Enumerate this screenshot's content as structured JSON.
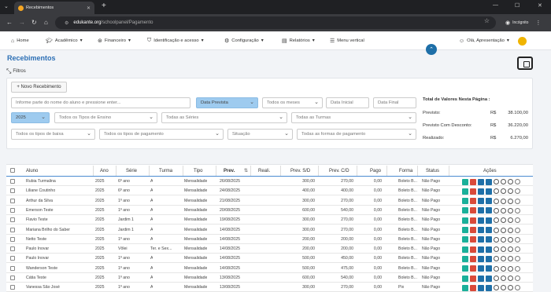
{
  "browser": {
    "tab_title": "Recebimentos",
    "url_host": "edukante.org",
    "url_path": "/schoolpanel/Pagamento",
    "incognito_label": "Incógnito"
  },
  "nav": {
    "home": "Home",
    "academico": "Acadêmico",
    "financeiro": "Financeiro",
    "identificacao": "Identificação e acesso",
    "configuracao": "Configuração",
    "relatorios": "Relatórios",
    "menu_vertical": "Menu vertical",
    "greeting": "Olá, Apresentação"
  },
  "page": {
    "title": "Recebimentos",
    "filters_label": "Filtros",
    "new_button": "+ Novo Recebimento"
  },
  "filters": {
    "search_placeholder": "Informe parte do nome do aluno e pressione enter...",
    "prevista": "Data Prevista",
    "todos_meses": "Todos os meses",
    "data_inicial": "Data Inicial",
    "data_final": "Data Final",
    "ano": "2025",
    "tipos_ensino": "Todos os Tipos de Ensino",
    "series": "Todas as Séries",
    "turmas": "Todas as Turmas",
    "tipos_baixa": "Todos os tipos de baixa",
    "tipos_pagamento": "Todos os tipos de pagamento",
    "situacao": "Situação",
    "formas_pagamento": "Todas as formas de pagamento"
  },
  "totals": {
    "title": "Total de Valores Nesta Página :",
    "rows": [
      {
        "label": "Previsto:",
        "currency": "R$",
        "value": "38.100,00"
      },
      {
        "label": "Previsto Com Desconto:",
        "currency": "R$",
        "value": "36.220,00"
      },
      {
        "label": "Realizado:",
        "currency": "R$",
        "value": "6.270,00"
      }
    ]
  },
  "table": {
    "headers": [
      "Aluno",
      "Ano",
      "Série",
      "Turma",
      "Tipo",
      "Prev.",
      "Reali.",
      "Prev. S/D",
      "Prev. C/D",
      "Pago",
      "Forma",
      "Status",
      "Ações"
    ],
    "rows": [
      [
        "Rubia Turmalina",
        "2025",
        "6º ano",
        "A",
        "Mensalidade",
        "26/08/2025",
        "",
        "300,00",
        "270,00",
        "0,00",
        "Boleto B...",
        "Não Pago"
      ],
      [
        "Liliane Coutinho",
        "2025",
        "6º ano",
        "A",
        "Mensalidade",
        "24/08/2025",
        "",
        "400,00",
        "400,00",
        "0,00",
        "Boleto B...",
        "Não Pago"
      ],
      [
        "Arthur da Silva",
        "2025",
        "1º ano",
        "A",
        "Mensalidade",
        "21/08/2025",
        "",
        "300,00",
        "270,00",
        "0,00",
        "Boleto B...",
        "Não Pago"
      ],
      [
        "Emerson Teste",
        "2025",
        "1º ano",
        "A",
        "Mensalidade",
        "20/08/2025",
        "",
        "600,00",
        "540,00",
        "0,00",
        "Boleto B...",
        "Não Pago"
      ],
      [
        "Flavio Teste",
        "2025",
        "Jardim 1",
        "A",
        "Mensalidade",
        "19/08/2025",
        "",
        "300,00",
        "270,00",
        "0,00",
        "Boleto B...",
        "Não Pago"
      ],
      [
        "Mariana Brilho do Saber",
        "2025",
        "Jardim 1",
        "A",
        "Mensalidade",
        "14/08/2025",
        "",
        "300,00",
        "270,00",
        "0,00",
        "Boleto B...",
        "Não Pago"
      ],
      [
        "Netto Teste",
        "2025",
        "1º ano",
        "A",
        "Mensalidade",
        "14/08/2025",
        "",
        "200,00",
        "200,00",
        "0,00",
        "Boleto B...",
        "Não Pago"
      ],
      [
        "Paulo Inovar",
        "2025",
        "Vôlei",
        "Ter. e Sex...",
        "Mensalidade",
        "14/08/2025",
        "",
        "200,00",
        "200,00",
        "0,00",
        "Boleto B...",
        "Não Pago"
      ],
      [
        "Paulo Inovar",
        "2025",
        "1º ano",
        "A",
        "Mensalidade",
        "14/08/2025",
        "",
        "500,00",
        "450,00",
        "0,00",
        "Boleto B...",
        "Não Pago"
      ],
      [
        "Wanderson Teste",
        "2025",
        "1º ano",
        "A",
        "Mensalidade",
        "14/08/2025",
        "",
        "500,00",
        "475,00",
        "0,00",
        "Boleto B...",
        "Não Pago"
      ],
      [
        "Cátia Teste",
        "2025",
        "1º ano",
        "A",
        "Mensalidade",
        "13/08/2025",
        "",
        "600,00",
        "540,00",
        "0,00",
        "Boleto B...",
        "Não Pago"
      ],
      [
        "Vanessa São José",
        "2025",
        "1º ano",
        "A",
        "Mensalidade",
        "13/08/2025",
        "",
        "300,00",
        "270,00",
        "0,00",
        "Pix",
        "Não Pago"
      ]
    ]
  },
  "colors": {
    "brand": "#2c6fb5",
    "accent": "#9ecbef",
    "header_line": "#4a8bd1"
  }
}
